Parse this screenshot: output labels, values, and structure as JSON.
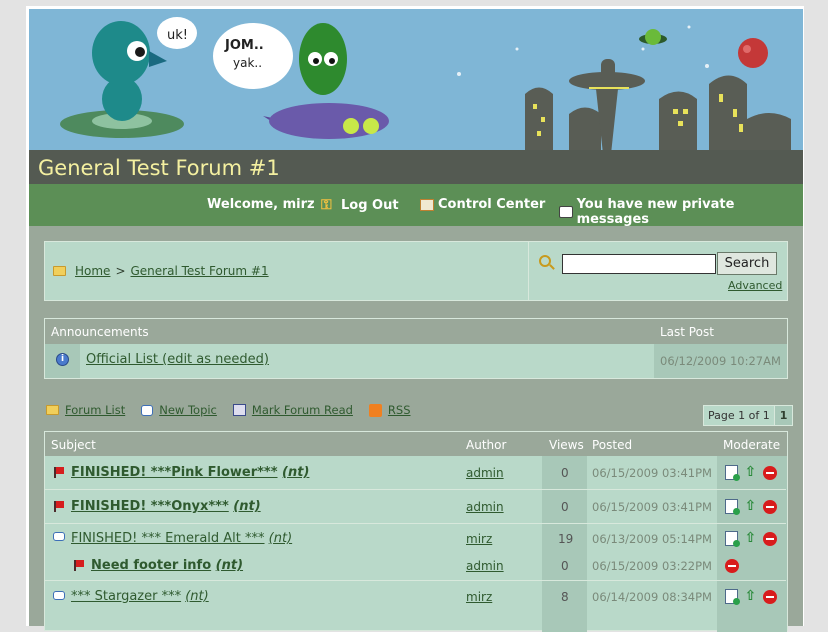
{
  "header": {
    "forum_title": "General Test Forum #1",
    "bubble_left": "uk!",
    "bubble_right_1": "JOM..",
    "bubble_right_2": "yak.."
  },
  "nav": {
    "welcome": "Welcome, mirz",
    "logout": "Log Out",
    "control_center": "Control Center",
    "private_messages": "You have new private messages"
  },
  "breadcrumb": {
    "home": "Home",
    "separator": ">",
    "forum": "General Test Forum #1"
  },
  "search": {
    "button": "Search",
    "advanced": "Advanced",
    "value": ""
  },
  "announcements": {
    "header": "Announcements",
    "last_post_header": "Last Post",
    "items": [
      {
        "title": "Official List (edit as needed)",
        "date": "06/12/2009 10:27AM"
      }
    ]
  },
  "toolbar": {
    "forum_list": "Forum List",
    "new_topic": "New Topic",
    "mark_read": "Mark Forum Read",
    "rss": "RSS",
    "page_info": "Page 1 of 1",
    "page_num": "1"
  },
  "topics": {
    "headers": {
      "subject": "Subject",
      "author": "Author",
      "views": "Views",
      "posted": "Posted",
      "moderate": "Moderate"
    },
    "rows": [
      {
        "subject": "FINISHED! ***Pink Flower***",
        "nt": "(nt)",
        "author": "admin",
        "views": "0",
        "posted": "06/15/2009 03:41PM",
        "icon": "red-flag-icon",
        "bold": true
      },
      {
        "subject": "FINISHED! ***Onyx***",
        "nt": "(nt)",
        "author": "admin",
        "views": "0",
        "posted": "06/15/2009 03:41PM",
        "icon": "red-flag-icon",
        "bold": true
      },
      {
        "subject": "FINISHED! *** Emerald Alt ***",
        "nt": "(nt)",
        "author": "mirz",
        "views": "19",
        "posted": "06/13/2009 05:14PM",
        "icon": "speech-bubble-icon",
        "bold": false
      },
      {
        "subject": "Need footer info",
        "nt": "(nt)",
        "author": "admin",
        "views": "0",
        "posted": "06/15/2009 03:22PM",
        "icon": "red-flag-icon",
        "bold": true
      },
      {
        "subject": "*** Stargazer ***",
        "nt": "(nt)",
        "author": "mirz",
        "views": "8",
        "posted": "06/14/2009 08:34PM",
        "icon": "speech-bubble-icon",
        "bold": false
      }
    ]
  }
}
